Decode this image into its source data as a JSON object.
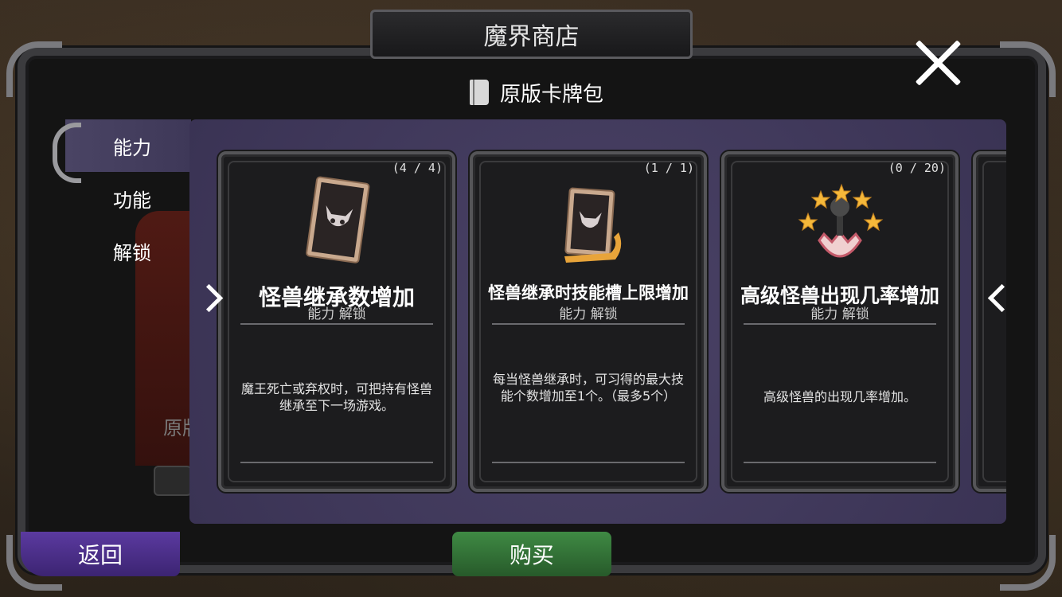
{
  "header": {
    "title": "魔界商店",
    "subtitle": "原版卡牌包"
  },
  "sidebar": {
    "tabs": [
      {
        "label": "能力"
      },
      {
        "label": "功能"
      },
      {
        "label": "解锁"
      }
    ]
  },
  "background_hint": {
    "text": "原版"
  },
  "cards": [
    {
      "count": "(4 / 4)",
      "title": "怪兽继承数增加",
      "subtitle": "能力 解锁",
      "description": "魔王死亡或弃权时，可把持有怪兽继承至下一场游戏。",
      "icon": "monster-card-icon"
    },
    {
      "count": "(1 / 1)",
      "title": "怪兽继承时技能槽上限增加",
      "subtitle": "能力 解锁",
      "description": "每当怪兽继承时，可习得的最大技能个数增加至1个。（最多5个）",
      "icon": "monster-card-scroll-icon"
    },
    {
      "count": "(0 / 20)",
      "title": "高级怪兽出现几率增加",
      "subtitle": "能力 解锁",
      "description": "高级怪兽的出现几率增加。",
      "icon": "star-egg-icon"
    }
  ],
  "buttons": {
    "back": "返回",
    "buy": "购买"
  },
  "colors": {
    "panel": "#3a3354",
    "back_button": "#4a2e88",
    "buy_button": "#327036",
    "highlight_number": "#f2c94c"
  }
}
